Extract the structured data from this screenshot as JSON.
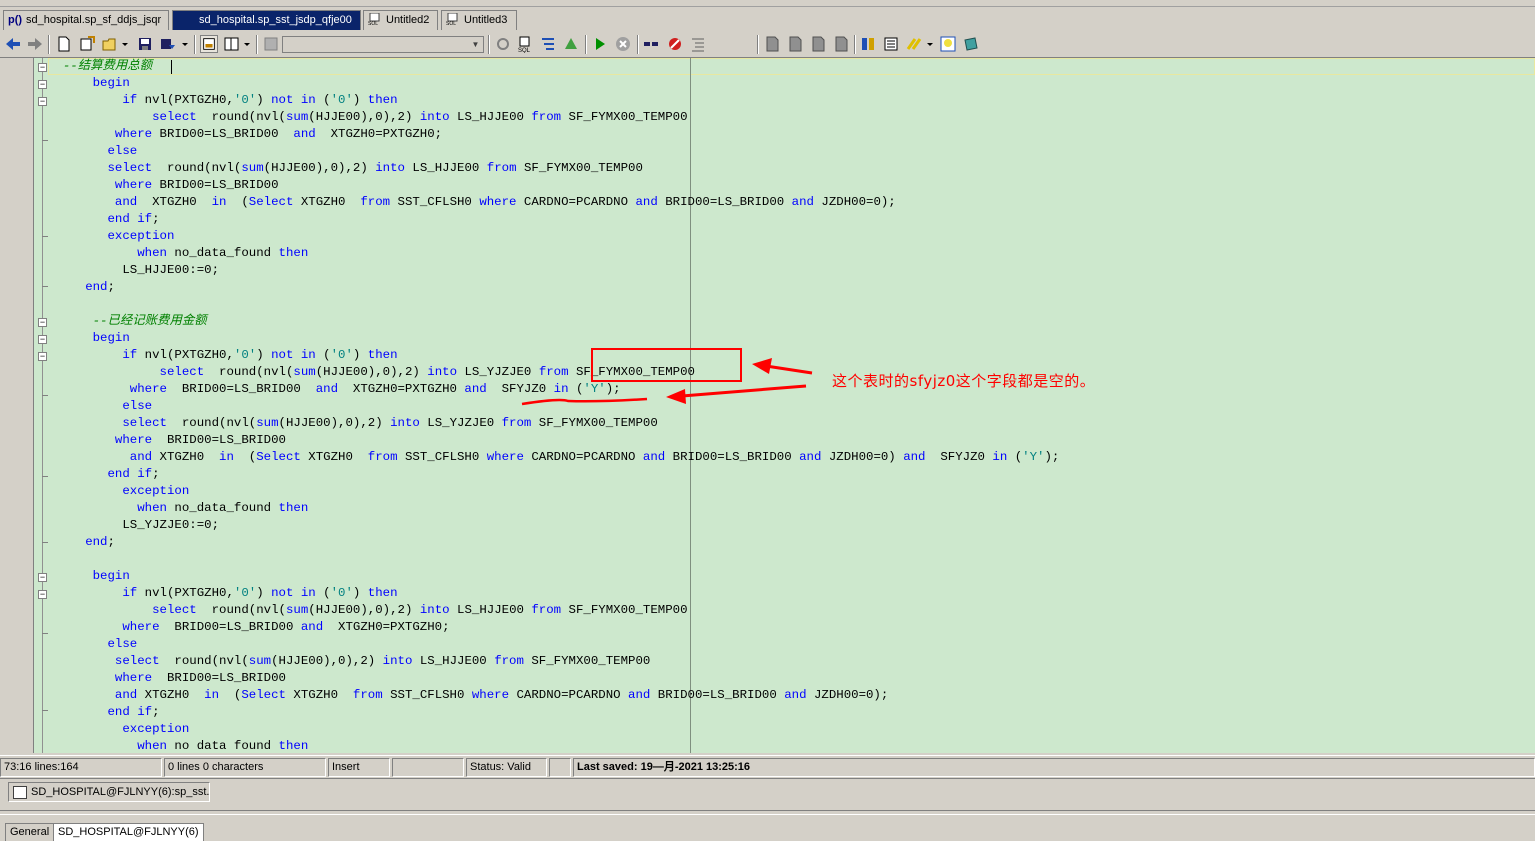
{
  "tabs": [
    {
      "label": "sd_hospital.sp_sf_ddjs_jsqr",
      "icon": "procedure-icon",
      "active": false
    },
    {
      "label": "sd_hospital.sp_sst_jsdp_qfje00",
      "icon": "procedure-icon",
      "active": true
    },
    {
      "label": "Untitled2",
      "icon": "sql-icon",
      "active": false
    },
    {
      "label": "Untitled3",
      "icon": "sql-icon",
      "active": false
    }
  ],
  "tab_prefix": "p()",
  "toolbar": {
    "combo_value": "",
    "icons": [
      "back-icon",
      "forward-icon",
      "new-icon",
      "open-icon",
      "open-dropdown-icon",
      "save-icon",
      "save-as-icon",
      "window-list-icon",
      "layout-icon",
      "grid-icon",
      "refresh-icon",
      "sql-history-icon",
      "explain-plan-icon",
      "compile-icon",
      "execute-icon",
      "stop-icon",
      "link-icon",
      "breakpoint-icon",
      "format-icon",
      "doc-1-icon",
      "doc-2-icon",
      "doc-3-icon",
      "doc-4-icon",
      "tools-icon",
      "list-icon",
      "highlight-icon",
      "bulb-icon",
      "plugin-icon"
    ]
  },
  "code_lines": [
    [
      {
        "t": "  --结算费用总额",
        "c": "cm"
      }
    ],
    [
      {
        "t": "      "
      },
      {
        "t": "begin",
        "c": "kw"
      }
    ],
    [
      {
        "t": "          "
      },
      {
        "t": "if",
        "c": "kw"
      },
      {
        "t": " nvl(PXTGZH0,"
      },
      {
        "t": "'0'",
        "c": "str"
      },
      {
        "t": ") "
      },
      {
        "t": "not in",
        "c": "kw"
      },
      {
        "t": " ("
      },
      {
        "t": "'0'",
        "c": "str"
      },
      {
        "t": ") "
      },
      {
        "t": "then",
        "c": "kw"
      }
    ],
    [
      {
        "t": "              "
      },
      {
        "t": "select",
        "c": "kw"
      },
      {
        "t": "  round(nvl("
      },
      {
        "t": "sum",
        "c": "fn"
      },
      {
        "t": "(HJJE00),0),2) "
      },
      {
        "t": "into",
        "c": "kw"
      },
      {
        "t": " LS_HJJE00 "
      },
      {
        "t": "from",
        "c": "kw"
      },
      {
        "t": " SF_FYMX00_TEMP00"
      }
    ],
    [
      {
        "t": "         "
      },
      {
        "t": "where",
        "c": "kw"
      },
      {
        "t": " BRID00=LS_BRID00  "
      },
      {
        "t": "and",
        "c": "kw"
      },
      {
        "t": "  XTGZH0=PXTGZH0;"
      }
    ],
    [
      {
        "t": "        "
      },
      {
        "t": "else",
        "c": "kw"
      }
    ],
    [
      {
        "t": "        "
      },
      {
        "t": "select",
        "c": "kw"
      },
      {
        "t": "  round(nvl("
      },
      {
        "t": "sum",
        "c": "fn"
      },
      {
        "t": "(HJJE00),0),2) "
      },
      {
        "t": "into",
        "c": "kw"
      },
      {
        "t": " LS_HJJE00 "
      },
      {
        "t": "from",
        "c": "kw"
      },
      {
        "t": " SF_FYMX00_TEMP00"
      }
    ],
    [
      {
        "t": "         "
      },
      {
        "t": "where",
        "c": "kw"
      },
      {
        "t": " BRID00=LS_BRID00"
      }
    ],
    [
      {
        "t": "         "
      },
      {
        "t": "and",
        "c": "kw"
      },
      {
        "t": "  XTGZH0  "
      },
      {
        "t": "in",
        "c": "kw"
      },
      {
        "t": "  ("
      },
      {
        "t": "Select",
        "c": "kw"
      },
      {
        "t": " XTGZH0  "
      },
      {
        "t": "from",
        "c": "kw"
      },
      {
        "t": " SST_CFLSH0 "
      },
      {
        "t": "where",
        "c": "kw"
      },
      {
        "t": " CARDNO=PCARDNO "
      },
      {
        "t": "and",
        "c": "kw"
      },
      {
        "t": " BRID00=LS_BRID00 "
      },
      {
        "t": "and",
        "c": "kw"
      },
      {
        "t": " JZDH00=0);"
      }
    ],
    [
      {
        "t": "        "
      },
      {
        "t": "end if",
        "c": "kw"
      },
      {
        "t": ";"
      }
    ],
    [
      {
        "t": "        "
      },
      {
        "t": "exception",
        "c": "kw"
      }
    ],
    [
      {
        "t": "            "
      },
      {
        "t": "when",
        "c": "kw"
      },
      {
        "t": " no_data_found "
      },
      {
        "t": "then",
        "c": "kw"
      }
    ],
    [
      {
        "t": "          LS_HJJE00:=0;"
      }
    ],
    [
      {
        "t": "     "
      },
      {
        "t": "end",
        "c": "kw"
      },
      {
        "t": ";"
      }
    ],
    [
      {
        "t": ""
      }
    ],
    [
      {
        "t": "      --已经记账费用金额",
        "c": "cm"
      }
    ],
    [
      {
        "t": "      "
      },
      {
        "t": "begin",
        "c": "kw"
      }
    ],
    [
      {
        "t": "          "
      },
      {
        "t": "if",
        "c": "kw"
      },
      {
        "t": " nvl(PXTGZH0,"
      },
      {
        "t": "'0'",
        "c": "str"
      },
      {
        "t": ") "
      },
      {
        "t": "not in",
        "c": "kw"
      },
      {
        "t": " ("
      },
      {
        "t": "'0'",
        "c": "str"
      },
      {
        "t": ") "
      },
      {
        "t": "then",
        "c": "kw"
      }
    ],
    [
      {
        "t": "               "
      },
      {
        "t": "select",
        "c": "kw"
      },
      {
        "t": "  round(nvl("
      },
      {
        "t": "sum",
        "c": "fn"
      },
      {
        "t": "(HJJE00),0),2) "
      },
      {
        "t": "into",
        "c": "kw"
      },
      {
        "t": " LS_YJZJE0 "
      },
      {
        "t": "from",
        "c": "kw"
      },
      {
        "t": " SF_FYMX00_TEMP00"
      }
    ],
    [
      {
        "t": "           "
      },
      {
        "t": "where",
        "c": "kw"
      },
      {
        "t": "  BRID00=LS_BRID00  "
      },
      {
        "t": "and",
        "c": "kw"
      },
      {
        "t": "  XTGZH0=PXTGZH0 "
      },
      {
        "t": "and",
        "c": "kw"
      },
      {
        "t": "  SFYJZ0 "
      },
      {
        "t": "in",
        "c": "kw"
      },
      {
        "t": " ("
      },
      {
        "t": "'Y'",
        "c": "str"
      },
      {
        "t": ");"
      }
    ],
    [
      {
        "t": "          "
      },
      {
        "t": "else",
        "c": "kw"
      }
    ],
    [
      {
        "t": "          "
      },
      {
        "t": "select",
        "c": "kw"
      },
      {
        "t": "  round(nvl("
      },
      {
        "t": "sum",
        "c": "fn"
      },
      {
        "t": "(HJJE00),0),2) "
      },
      {
        "t": "into",
        "c": "kw"
      },
      {
        "t": " LS_YJZJE0 "
      },
      {
        "t": "from",
        "c": "kw"
      },
      {
        "t": " SF_FYMX00_TEMP00"
      }
    ],
    [
      {
        "t": "         "
      },
      {
        "t": "where",
        "c": "kw"
      },
      {
        "t": "  BRID00=LS_BRID00"
      }
    ],
    [
      {
        "t": "           "
      },
      {
        "t": "and",
        "c": "kw"
      },
      {
        "t": " XTGZH0  "
      },
      {
        "t": "in",
        "c": "kw"
      },
      {
        "t": "  ("
      },
      {
        "t": "Select",
        "c": "kw"
      },
      {
        "t": " XTGZH0  "
      },
      {
        "t": "from",
        "c": "kw"
      },
      {
        "t": " SST_CFLSH0 "
      },
      {
        "t": "where",
        "c": "kw"
      },
      {
        "t": " CARDNO=PCARDNO "
      },
      {
        "t": "and",
        "c": "kw"
      },
      {
        "t": " BRID00=LS_BRID00 "
      },
      {
        "t": "and",
        "c": "kw"
      },
      {
        "t": " JZDH00=0) "
      },
      {
        "t": "and",
        "c": "kw"
      },
      {
        "t": "  SFYJZ0 "
      },
      {
        "t": "in",
        "c": "kw"
      },
      {
        "t": " ("
      },
      {
        "t": "'Y'",
        "c": "str"
      },
      {
        "t": ");"
      }
    ],
    [
      {
        "t": "        "
      },
      {
        "t": "end if",
        "c": "kw"
      },
      {
        "t": ";"
      }
    ],
    [
      {
        "t": "          "
      },
      {
        "t": "exception",
        "c": "kw"
      }
    ],
    [
      {
        "t": "            "
      },
      {
        "t": "when",
        "c": "kw"
      },
      {
        "t": " no_data_found "
      },
      {
        "t": "then",
        "c": "kw"
      }
    ],
    [
      {
        "t": "          LS_YJZJE0:=0;"
      }
    ],
    [
      {
        "t": "     "
      },
      {
        "t": "end",
        "c": "kw"
      },
      {
        "t": ";"
      }
    ],
    [
      {
        "t": ""
      }
    ],
    [
      {
        "t": "      "
      },
      {
        "t": "begin",
        "c": "kw"
      }
    ],
    [
      {
        "t": "          "
      },
      {
        "t": "if",
        "c": "kw"
      },
      {
        "t": " nvl(PXTGZH0,"
      },
      {
        "t": "'0'",
        "c": "str"
      },
      {
        "t": ") "
      },
      {
        "t": "not in",
        "c": "kw"
      },
      {
        "t": " ("
      },
      {
        "t": "'0'",
        "c": "str"
      },
      {
        "t": ") "
      },
      {
        "t": "then",
        "c": "kw"
      }
    ],
    [
      {
        "t": "              "
      },
      {
        "t": "select",
        "c": "kw"
      },
      {
        "t": "  round(nvl("
      },
      {
        "t": "sum",
        "c": "fn"
      },
      {
        "t": "(HJJE00),0),2) "
      },
      {
        "t": "into",
        "c": "kw"
      },
      {
        "t": " LS_HJJE00 "
      },
      {
        "t": "from",
        "c": "kw"
      },
      {
        "t": " SF_FYMX00_TEMP00"
      }
    ],
    [
      {
        "t": "          "
      },
      {
        "t": "where",
        "c": "kw"
      },
      {
        "t": "  BRID00=LS_BRID00 "
      },
      {
        "t": "and",
        "c": "kw"
      },
      {
        "t": "  XTGZH0=PXTGZH0;"
      }
    ],
    [
      {
        "t": "        "
      },
      {
        "t": "else",
        "c": "kw"
      }
    ],
    [
      {
        "t": "         "
      },
      {
        "t": "select",
        "c": "kw"
      },
      {
        "t": "  round(nvl("
      },
      {
        "t": "sum",
        "c": "fn"
      },
      {
        "t": "(HJJE00),0),2) "
      },
      {
        "t": "into",
        "c": "kw"
      },
      {
        "t": " LS_HJJE00 "
      },
      {
        "t": "from",
        "c": "kw"
      },
      {
        "t": " SF_FYMX00_TEMP00"
      }
    ],
    [
      {
        "t": "         "
      },
      {
        "t": "where",
        "c": "kw"
      },
      {
        "t": "  BRID00=LS_BRID00"
      }
    ],
    [
      {
        "t": "         "
      },
      {
        "t": "and",
        "c": "kw"
      },
      {
        "t": " XTGZH0  "
      },
      {
        "t": "in",
        "c": "kw"
      },
      {
        "t": "  ("
      },
      {
        "t": "Select",
        "c": "kw"
      },
      {
        "t": " XTGZH0  "
      },
      {
        "t": "from",
        "c": "kw"
      },
      {
        "t": " SST_CFLSH0 "
      },
      {
        "t": "where",
        "c": "kw"
      },
      {
        "t": " CARDNO=PCARDNO "
      },
      {
        "t": "and",
        "c": "kw"
      },
      {
        "t": " BRID00=LS_BRID00 "
      },
      {
        "t": "and",
        "c": "kw"
      },
      {
        "t": " JZDH00=0);"
      }
    ],
    [
      {
        "t": "        "
      },
      {
        "t": "end if",
        "c": "kw"
      },
      {
        "t": ";"
      }
    ],
    [
      {
        "t": "          "
      },
      {
        "t": "exception",
        "c": "kw"
      }
    ],
    [
      {
        "t": "            "
      },
      {
        "t": "when",
        "c": "kw"
      },
      {
        "t": " no data found "
      },
      {
        "t": "then",
        "c": "kw"
      }
    ]
  ],
  "annotation": {
    "text": "这个表时的sfyjz0这个字段都是空的。",
    "color": "#ff0000"
  },
  "status": {
    "position": "73:16 lines:164",
    "selection": "0 lines 0 characters",
    "mode": "Insert",
    "blank": "",
    "status": "Status: Valid",
    "blank2": "",
    "last_saved": "Last saved: 19—月-2021 13:25:16"
  },
  "window_task": {
    "label": "SD_HOSPITAL@FJLNYY(6):sp_sst..."
  },
  "bottom_tabs": [
    {
      "label": "General",
      "active": false
    },
    {
      "label": "SD_HOSPITAL@FJLNYY(6)",
      "active": true
    }
  ],
  "colors": {
    "editor_bg": "#cde8cd",
    "keyword": "#0000ff",
    "string": "#008080",
    "comment": "#008000",
    "active_tab": "#0a246a"
  }
}
